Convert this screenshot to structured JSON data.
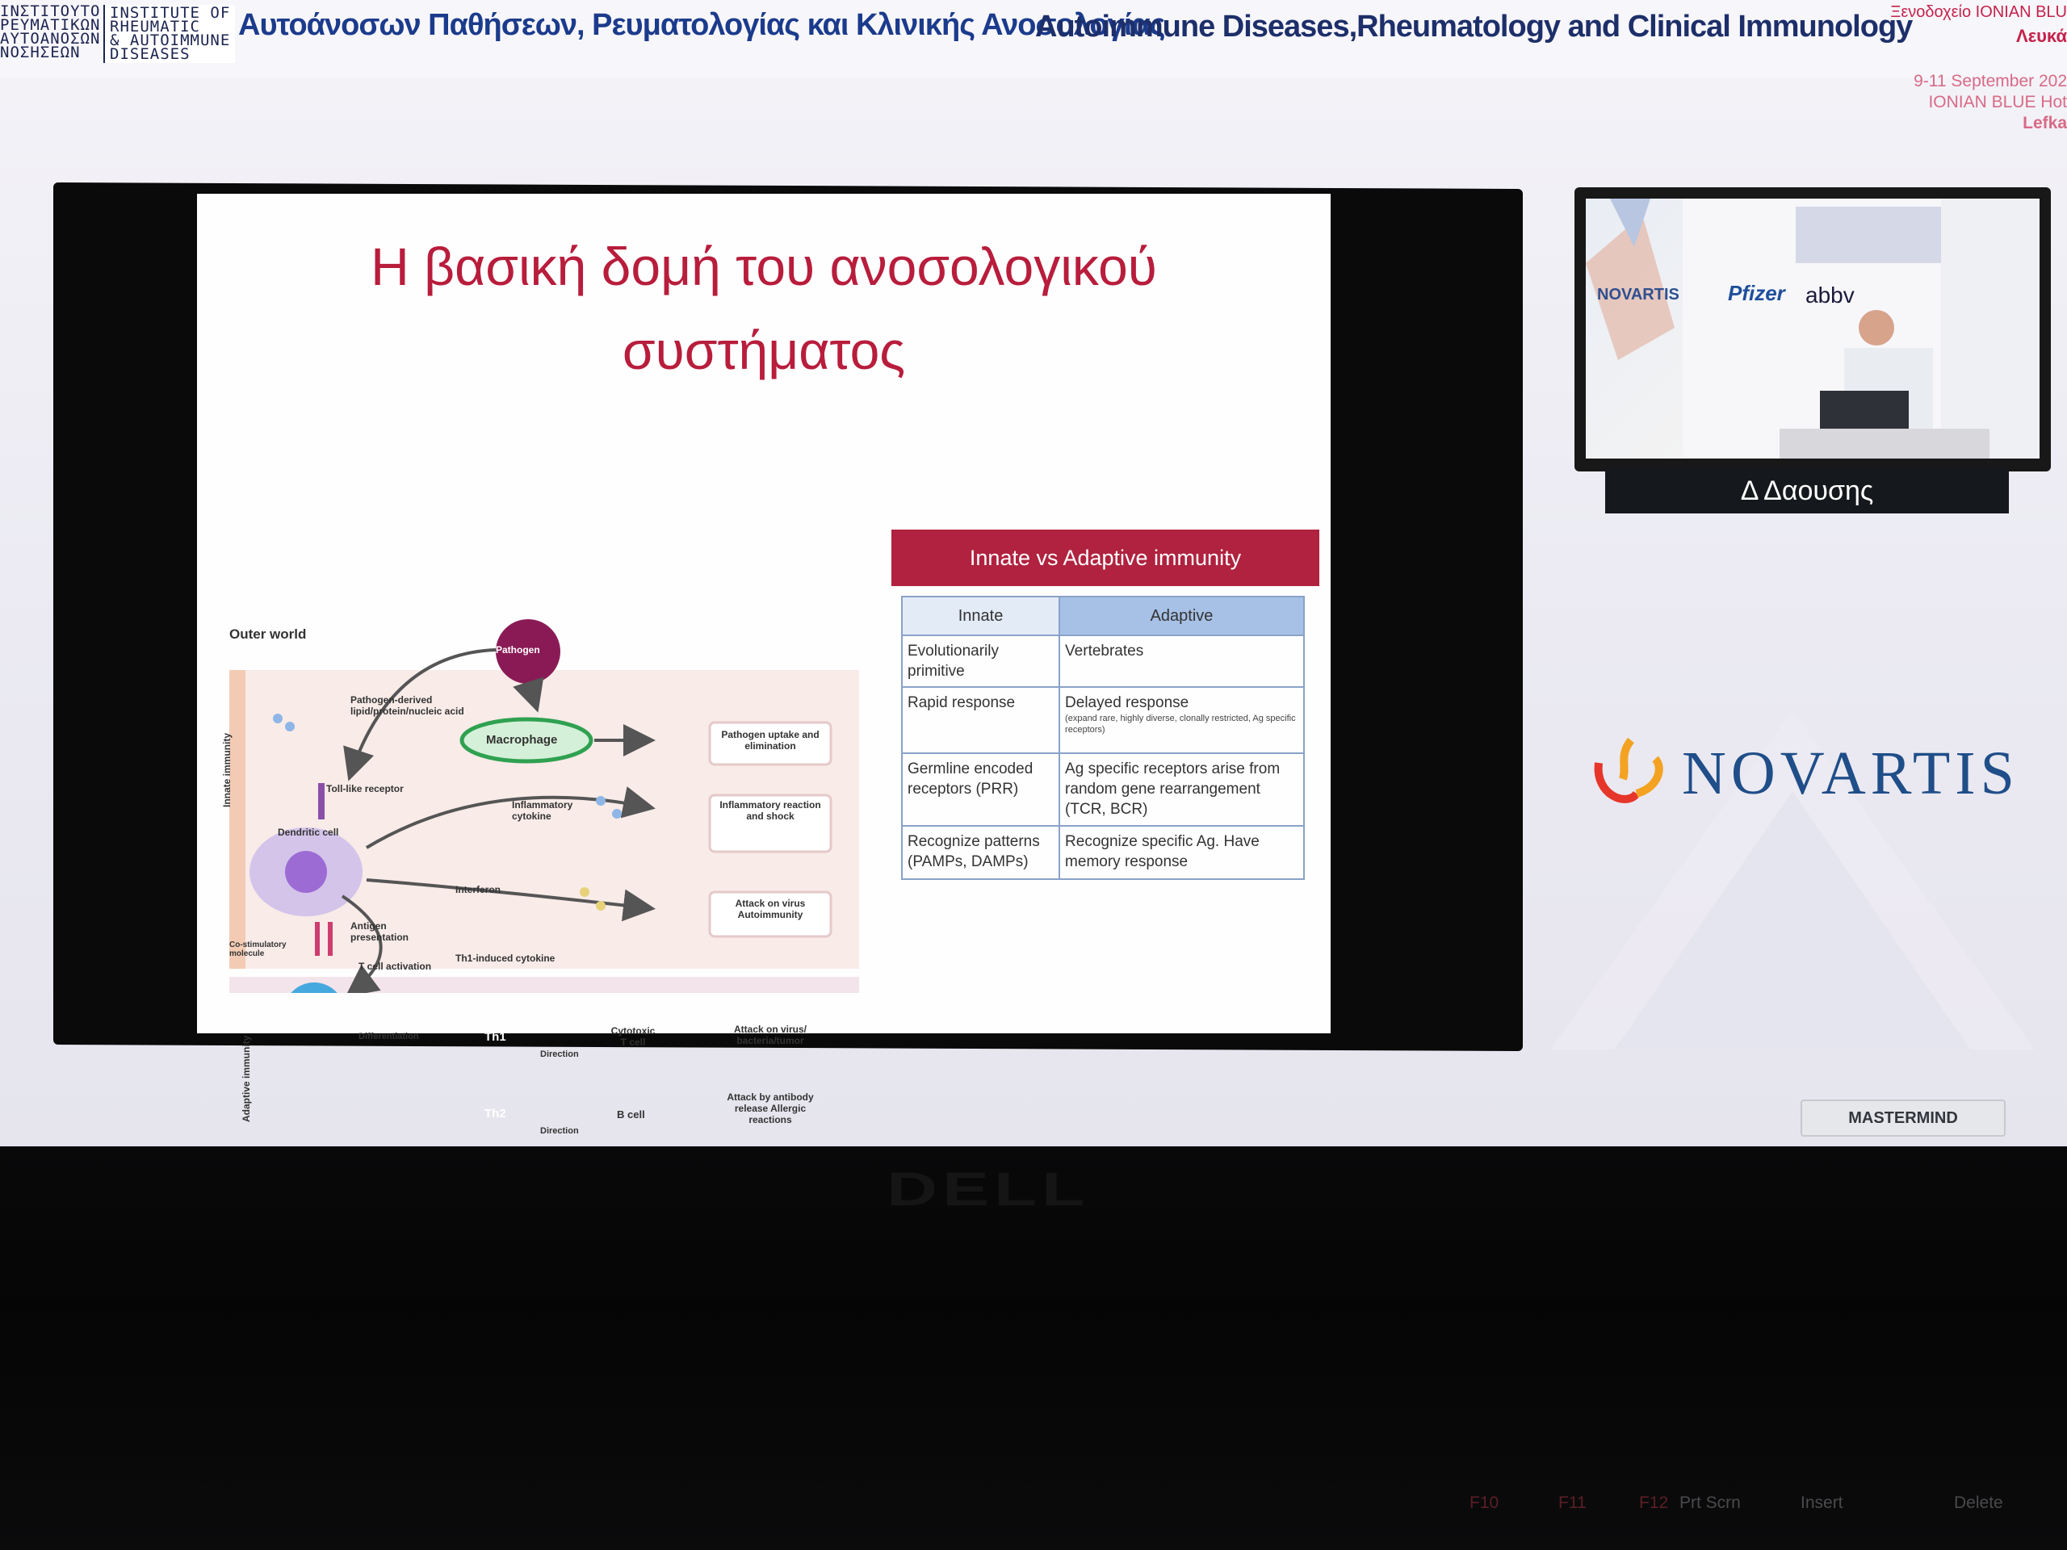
{
  "banner": {
    "institute_logo_left": "ΙΝΣΤΙΤΟΥΤΟ\nΡΕΥΜΑΤΙΚΩΝ\nΑΥΤΟΑΝΟΣΩΝ\nΝΟΣΗΣΕΩΝ",
    "institute_logo_right": "INSTITUTE OF\nRHEUMATIC\n& AUTOIMMUNE\nDISEASES",
    "title_greek": "Αυτοάνοσων Παθήσεων, Ρευματολογίας και Κλινικής Ανοσολογίας",
    "title_english": "Autoimmune Diseases,Rheumatology and Clinical Immunology",
    "hotel": "Ξενοδοχείο IONIAN BLU",
    "city_greek": "Λευκά",
    "dates": "9-11 September 202",
    "hotel_english": "IONIAN BLUE Hot",
    "city_english": "Lefka"
  },
  "slide": {
    "title_line1": "Η βασική δομή του ανοσολογικού",
    "title_line2": "συστήματος",
    "table_header": "Innate vs Adaptive immunity",
    "table": {
      "columns": [
        "Innate",
        "Adaptive"
      ],
      "rows": [
        {
          "innate": "Evolutionarily primitive",
          "adaptive": "Vertebrates",
          "note": ""
        },
        {
          "innate": "Rapid response",
          "adaptive": "Delayed response",
          "note": "(expand rare, highly diverse, clonally restricted, Ag specific receptors)"
        },
        {
          "innate": "Germline encoded receptors (PRR)",
          "adaptive": "Ag specific receptors arise from random gene rearrangement (TCR, BCR)",
          "note": ""
        },
        {
          "innate": "Recognize patterns (PAMPs, DAMPs)",
          "adaptive": "Recognize specific Ag. Have memory response",
          "note": ""
        }
      ]
    },
    "diagram": {
      "outer_world": "Outer world",
      "pathogen": "Pathogen",
      "pathogen_derived": "Pathogen-derived lipid/protein/nucleic acid",
      "macrophage": "Macrophage",
      "pathogen_uptake": "Pathogen uptake and elimination",
      "innate_immunity": "Innate immunity",
      "toll_like": "Toll-like receptor",
      "dendritic": "Dendritic cell",
      "inflam_cytokine": "Inflammatory cytokine",
      "inflam_reaction": "Inflammatory reaction and shock",
      "interferon": "Interferon",
      "attack_virus": "Attack on virus Autoimmunity",
      "antigen_presentation": "Antigen presentation",
      "co_stim": "Co-stimulatory molecule",
      "t_activation": "T cell activation",
      "th1_cytokine": "Th1-induced cytokine",
      "adaptive_immunity": "Adaptive immunity",
      "t_cell": "T cell",
      "differentiation": "Differentiation",
      "th1": "Th1",
      "cytotoxic": "Cytotoxic T cell",
      "attack_bacteria": "Attack on virus/ bacteria/tumor",
      "th2": "Th2",
      "b_cell": "B cell",
      "direction": "Direction",
      "attack_antibody": "Attack by antibody release Allergic reactions"
    }
  },
  "video": {
    "speaker_name": "Δ Δαουσης",
    "sponsors": [
      "NOVARTIS",
      "Pfizer",
      "abbv"
    ]
  },
  "sponsor_logo": "NOVARTIS",
  "mastermind_label": "MASTERMIND",
  "laptop": {
    "brand": "DELL",
    "keys": [
      "F10",
      "F11",
      "F12",
      "Prt Scrn",
      "Insert",
      "Delete"
    ]
  },
  "colors": {
    "slide_title": "#b81d3c",
    "table_header": "#b0223f",
    "novartis_blue": "#1f4e89",
    "banner_blue": "#1b3b8c"
  }
}
